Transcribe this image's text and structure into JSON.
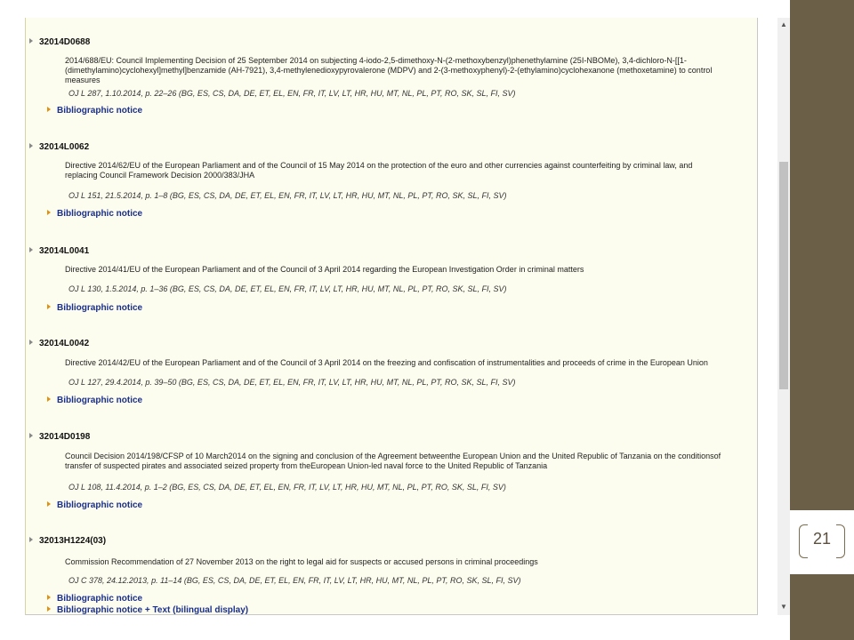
{
  "slide": {
    "page_number": "21"
  },
  "entries": [
    {
      "celex": "32014D0688",
      "description": "2014/688/EU: Council Implementing Decision of 25 September 2014 on subjecting 4-iodo-2,5-dimethoxy-N-(2-methoxybenzyl)phenethylamine (25I-NBOMe), 3,4-dichloro-N-[[1-(dimethylamino)cyclohexyl]methyl]benzamide (AH-7921), 3,4-methylenedioxypyrovalerone (MDPV) and 2-(3-methoxyphenyl)-2-(ethylamino)cyclohexanone (methoxetamine) to control measures",
      "oj": "OJ L 287, 1.10.2014, p. 22–26 (BG, ES, CS, DA, DE, ET, EL, EN, FR, IT, LV, LT, HR, HU, MT, NL, PL, PT, RO, SK, SL, FI, SV)",
      "link": "Bibliographic notice"
    },
    {
      "celex": "32014L0062",
      "description": "Directive 2014/62/EU of the European Parliament and of the Council of 15 May 2014 on the protection of the euro and other currencies against counterfeiting by criminal law, and replacing Council Framework Decision 2000/383/JHA",
      "oj": "OJ L 151, 21.5.2014, p. 1–8 (BG, ES, CS, DA, DE, ET, EL, EN, FR, IT, LV, LT, HR, HU, MT, NL, PL, PT, RO, SK, SL, FI, SV)",
      "link": "Bibliographic notice"
    },
    {
      "celex": "32014L0041",
      "description": "Directive 2014/41/EU of the European Parliament and of the Council of 3 April 2014 regarding the European Investigation Order in criminal matters",
      "oj": "OJ L 130, 1.5.2014, p. 1–36 (BG, ES, CS, DA, DE, ET, EL, EN, FR, IT, LV, LT, HR, HU, MT, NL, PL, PT, RO, SK, SL, FI, SV)",
      "link": "Bibliographic notice"
    },
    {
      "celex": "32014L0042",
      "description": "Directive 2014/42/EU of the European Parliament and of the Council of 3 April 2014 on the freezing and confiscation of instrumentalities and proceeds of crime in the European Union",
      "oj": "OJ L 127, 29.4.2014, p. 39–50 (BG, ES, CS, DA, DE, ET, EL, EN, FR, IT, LV, LT, HR, HU, MT, NL, PL, PT, RO, SK, SL, FI, SV)",
      "link": "Bibliographic notice"
    },
    {
      "celex": "32014D0198",
      "description": "Council Decision 2014/198/CFSP of 10 March2014 on the signing and conclusion of the Agreement betweenthe European Union and the United Republic of Tanzania on the conditionsof transfer of suspected pirates and associated seized property from theEuropean Union-led naval force to the United Republic of Tanzania",
      "oj": "OJ L 108, 11.4.2014, p. 1–2 (BG, ES, CS, DA, DE, ET, EL, EN, FR, IT, LV, LT, HR, HU, MT, NL, PL, PT, RO, SK, SL, FI, SV)",
      "link": "Bibliographic notice"
    },
    {
      "celex": "32013H1224(03)",
      "description": "Commission Recommendation of 27 November 2013 on the right to legal aid for suspects or accused persons in criminal proceedings",
      "oj": "OJ C 378, 24.12.2013, p. 11–14 (BG, ES, CS, DA, DE, ET, EL, EN, FR, IT, LV, LT, HR, HU, MT, NL, PL, PT, RO, SK, SL, FI, SV)",
      "link": "Bibliographic notice",
      "link2": "Bibliographic notice + Text (bilingual display)"
    }
  ]
}
